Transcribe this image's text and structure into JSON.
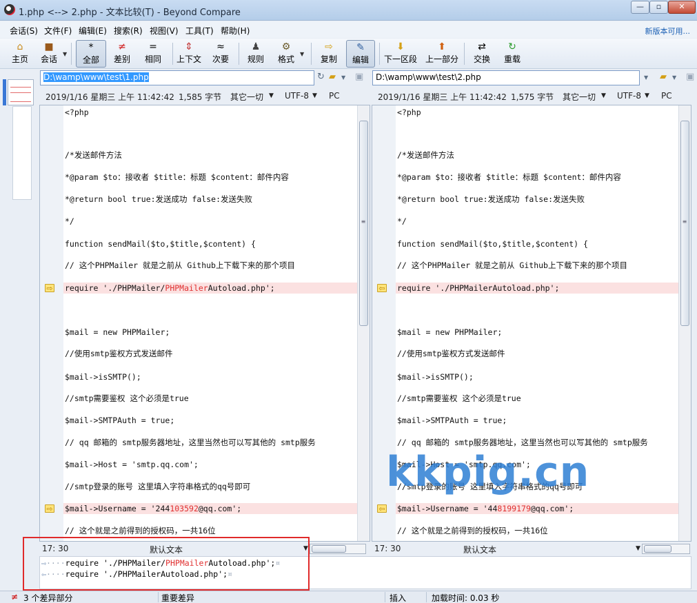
{
  "window": {
    "title": "1.php <--> 2.php - 文本比较(T) - Beyond Compare",
    "min_label": "—",
    "max_label": "▫",
    "close_label": "✕"
  },
  "menubar": {
    "items": [
      "会话(S)",
      "文件(F)",
      "编辑(E)",
      "搜索(R)",
      "视图(V)",
      "工具(T)",
      "帮助(H)"
    ],
    "update_link": "新版本可用..."
  },
  "toolbar": {
    "home": "主页",
    "session": "会话",
    "all": "全部",
    "diffs": "差别",
    "same": "相同",
    "context": "上下文",
    "minor": "次要",
    "rules": "规则",
    "format": "格式",
    "copy": "复制",
    "edit": "编辑",
    "next_section": "下一区段",
    "prev_section": "上一部分",
    "swap": "交换",
    "reload": "重载"
  },
  "left": {
    "path": "D:\\wamp\\www\\test\\1.php",
    "date": "2019/1/16 星期三 上午 11:42:42",
    "size": "1,585 字节",
    "line_end": "其它一切",
    "encoding": "UTF-8",
    "platform": "PC",
    "cursor": "17: 30",
    "text_type": "默认文本",
    "lines": [
      {
        "text": "<?php",
        "diff": false
      },
      {
        "text": "",
        "diff": false
      },
      {
        "text": "/*发送邮件方法",
        "diff": false
      },
      {
        "text": " *@param $to：接收者 $title：标题 $content：邮件内容",
        "diff": false
      },
      {
        "text": " *@return bool true:发送成功 false:发送失败",
        "diff": false
      },
      {
        "text": " */",
        "diff": false
      },
      {
        "text": "function sendMail($to,$title,$content) {",
        "diff": false
      },
      {
        "text": "    // 这个PHPMailer 就是之前从 Github上下载下来的那个项目",
        "diff": false
      },
      {
        "text": "    require './PHPMailer/",
        "hl": "PHPM",
        "mid": "ailer",
        "hl2": "",
        "tail": "Autoload.php';",
        "diff": true
      },
      {
        "text": "",
        "diff": false
      },
      {
        "text": "    $mail = new PHPMailer;",
        "diff": false
      },
      {
        "text": "    //使用smtp鉴权方式发送邮件",
        "diff": false
      },
      {
        "text": "    $mail->isSMTP();",
        "diff": false
      },
      {
        "text": "    //smtp需要鉴权 这个必须是true",
        "diff": false
      },
      {
        "text": "    $mail->SMTPAuth = true;",
        "diff": false
      },
      {
        "text": "    // qq 邮箱的 smtp服务器地址，这里当然也可以写其他的 smtp服务",
        "diff": false
      },
      {
        "text": "    $mail->Host = 'smtp.qq.com';",
        "diff": false
      },
      {
        "text": "    //smtp登录的账号 这里填入字符串格式的qq号即可",
        "diff": false
      },
      {
        "text": "    $mail->Username = '244",
        "hl": "103592",
        "tail": "@qq.com';",
        "diff": true
      },
      {
        "text": "    // 这个就是之前得到的授权码，一共16位",
        "diff": false
      }
    ]
  },
  "right": {
    "path": "D:\\wamp\\www\\test\\2.php",
    "date": "2019/1/16 星期三 上午 11:42:42",
    "size": "1,575 字节",
    "line_end": "其它一切",
    "encoding": "UTF-8",
    "platform": "PC",
    "cursor": "17: 30",
    "text_type": "默认文本",
    "lines": [
      {
        "text": "<?php",
        "diff": false
      },
      {
        "text": "",
        "diff": false
      },
      {
        "text": "/*发送邮件方法",
        "diff": false
      },
      {
        "text": " *@param $to：接收者 $title：标题 $content：邮件内容",
        "diff": false
      },
      {
        "text": " *@return bool true:发送成功 false:发送失败",
        "diff": false
      },
      {
        "text": " */",
        "diff": false
      },
      {
        "text": "function sendMail($to,$title,$content) {",
        "diff": false
      },
      {
        "text": "    // 这个PHPMailer 就是之前从 Github上下载下来的那个项目",
        "diff": false
      },
      {
        "text": "    require './PHPMailerAutoload.php';",
        "diff": true
      },
      {
        "text": "",
        "diff": false
      },
      {
        "text": "    $mail = new PHPMailer;",
        "diff": false
      },
      {
        "text": "    //使用smtp鉴权方式发送邮件",
        "diff": false
      },
      {
        "text": "    $mail->isSMTP();",
        "diff": false
      },
      {
        "text": "    //smtp需要鉴权 这个必须是true",
        "diff": false
      },
      {
        "text": "    $mail->SMTPAuth = true;",
        "diff": false
      },
      {
        "text": "    // qq 邮箱的 smtp服务器地址，这里当然也可以写其他的 smtp服务",
        "diff": false
      },
      {
        "text": "    $mail->Host = 'smtp.qq.com';",
        "diff": false
      },
      {
        "text": "    //smtp登录的账号 这里填入字符串格式的qq号即可",
        "diff": false
      },
      {
        "text": "    $mail->Username = '44",
        "hl": "8199179",
        "tail": "@qq.com';",
        "diff": true
      },
      {
        "text": "    // 这个就是之前得到的授权码，一共16位",
        "diff": false
      }
    ]
  },
  "line_detail": {
    "top_pre": "require './PHPMailer/",
    "top_hl": "PHPM",
    "top_mid": "ailer",
    "top_tail": "Autoload.php';",
    "bottom": "require './PHPMailerAutoload.php';",
    "dots": "····",
    "end_mark": "¤"
  },
  "statusbar": {
    "diff_count": "3 个差异部分",
    "important": "重要差异",
    "insert": "插入",
    "load_time": "加载时间: 0.03 秒"
  },
  "watermark": "kkpig.cn",
  "colors": {
    "diff_bg": "#fbe1e1",
    "diff_text": "#e03030",
    "accent": "#1a5fb4"
  }
}
